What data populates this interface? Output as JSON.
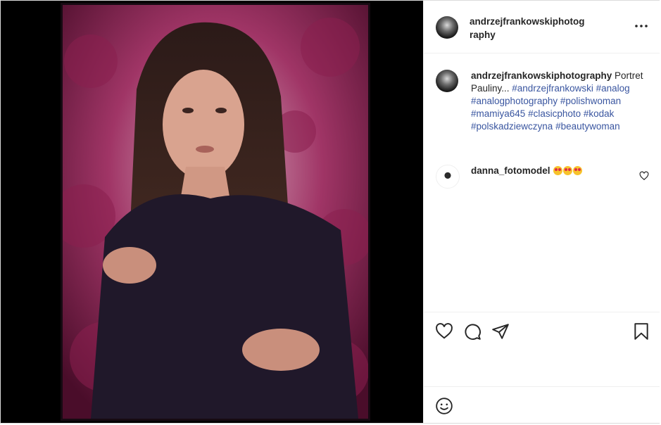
{
  "post": {
    "username": "andrzejfrankowskiphotography",
    "username_line1": "andrzejfrankowskiphotog",
    "username_line2": "raphy"
  },
  "caption": {
    "username": "andrzejfrankowskiphotography",
    "text": " Portret Pauliny... ",
    "tags": [
      "#andrzejfrankowski",
      "#analog",
      "#analogphotography",
      "#polishwoman",
      "#mamiya645",
      "#clasicphoto",
      "#kodak",
      "#polskadziewczyna",
      "#beautywoman"
    ]
  },
  "comments": [
    {
      "username": "danna_fotomodel",
      "emoji_count": 3
    }
  ],
  "icons": {
    "more": "more-horizontal-icon",
    "like": "heart-icon",
    "comment": "comment-bubble-icon",
    "share": "paper-plane-icon",
    "save": "bookmark-icon",
    "emoji": "smiley-icon",
    "comment_like": "small-heart-icon"
  },
  "colors": {
    "hashtag": "#3a56a0",
    "text": "#262626",
    "border": "#dbdbdb"
  }
}
